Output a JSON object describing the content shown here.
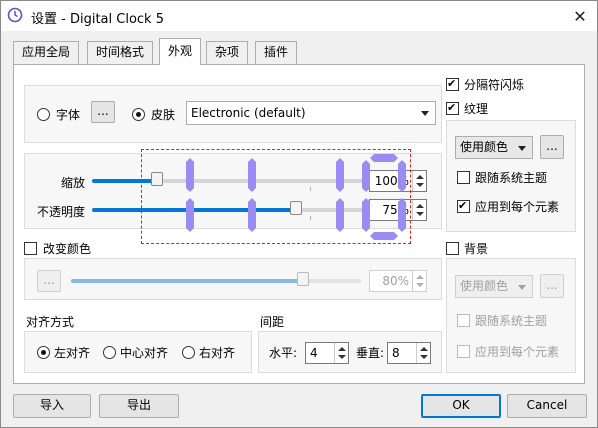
{
  "window": {
    "title": "设置 - Digital Clock 5",
    "close_glyph": "✕"
  },
  "tabs": [
    "应用全局",
    "时间格式",
    "外观",
    "杂项",
    "插件"
  ],
  "skin_section": {
    "font_label": "字体",
    "font_button": "...",
    "skin_label": "皮肤",
    "skin_value": "Electronic (default)"
  },
  "zoom": {
    "label": "缩放",
    "value_text": "100%",
    "level": 0.24
  },
  "opacity": {
    "label": "不透明度",
    "value_text": "75%",
    "level": 0.75
  },
  "change_color": {
    "label": "改变颜色",
    "button": "...",
    "value_text": "80%",
    "level": 0.8
  },
  "align": {
    "title": "对齐方式",
    "options": [
      "左对齐",
      "中心对齐",
      "右对齐"
    ],
    "selected": 0
  },
  "spacing": {
    "title": "间距",
    "h_label": "水平:",
    "h_value": "4",
    "v_label": "垂直:",
    "v_value": "8"
  },
  "separator_flash": {
    "label": "分隔符闪烁"
  },
  "texture": {
    "label": "纹理",
    "mode_value": "使用颜色",
    "button": "...",
    "follow_theme": "跟随系统主题",
    "apply_each": "应用到每个元素"
  },
  "background": {
    "label": "背景",
    "mode_value": "使用颜色",
    "button": "...",
    "follow_theme": "跟随系统主题",
    "apply_each": "应用到每个元素"
  },
  "footer": {
    "import": "导入",
    "export": "导出",
    "ok": "OK",
    "cancel": "Cancel"
  },
  "colors": {
    "accent": "#0078d7",
    "preview_digits": "#9a8cf2",
    "preview_border": "#e02020"
  }
}
